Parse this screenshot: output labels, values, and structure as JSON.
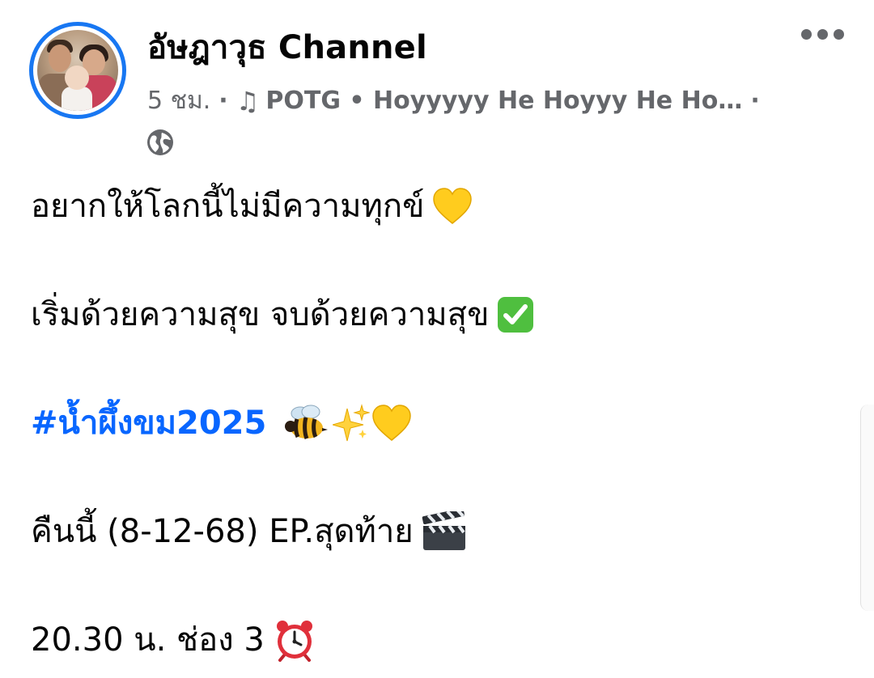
{
  "post": {
    "author": "อัษฎาวุธ Channel",
    "time": "5 ชม.",
    "music_icon": "music-note-icon",
    "song": "POTG • Hoyyyyy He Hoyyy He Ho…",
    "audience_icon": "globe-icon",
    "more_icon": "more-options-icon",
    "lines": {
      "l1": "อยากให้โลกนี้ไม่มีความทุกข์",
      "l2": "เริ่มด้วยความสุข จบด้วยความสุข",
      "hashtag": "#น้ำผึ้งขม2025",
      "l4": "คืนนี้ (8-12-68) EP.สุดท้าย",
      "l5": "20.30 น. ช่อง 3"
    },
    "emojis": [
      "yellow-heart",
      "check-mark-button",
      "bee",
      "sparkles",
      "yellow-heart",
      "clapper-board",
      "alarm-clock"
    ]
  },
  "colors": {
    "accent": "#1877f2",
    "hashtag": "#0866ff",
    "meta_text": "#65676b",
    "text": "#050505"
  }
}
